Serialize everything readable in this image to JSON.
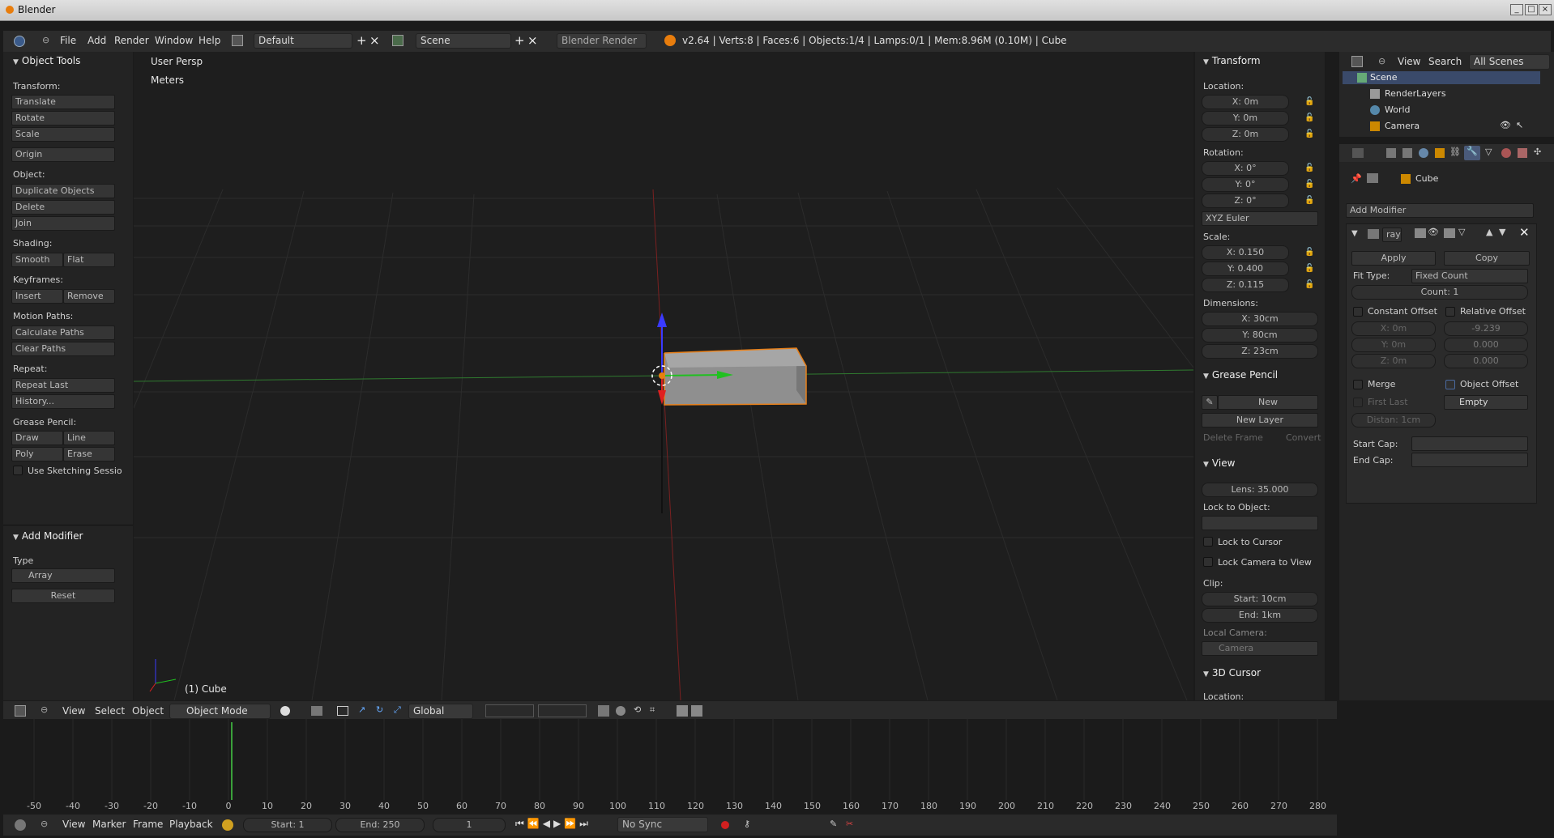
{
  "window": {
    "title": "Blender"
  },
  "header": {
    "menus": [
      "File",
      "Add",
      "Render",
      "Window",
      "Help"
    ],
    "screen_layout": "Default",
    "scene": "Scene",
    "render_engine": "Blender Render",
    "stats": "v2.64 | Verts:8 | Faces:6 | Objects:1/4 | Lamps:0/1 | Mem:8.96M (0.10M) | Cube"
  },
  "tools": {
    "title": "Object Tools",
    "transform_label": "Transform:",
    "translate": "Translate",
    "rotate": "Rotate",
    "scale": "Scale",
    "origin": "Origin",
    "object_label": "Object:",
    "duplicate": "Duplicate Objects",
    "delete": "Delete",
    "join": "Join",
    "shading_label": "Shading:",
    "smooth": "Smooth",
    "flat": "Flat",
    "keyframes_label": "Keyframes:",
    "insert": "Insert",
    "remove": "Remove",
    "motion_label": "Motion Paths:",
    "calc_paths": "Calculate Paths",
    "clear_paths": "Clear Paths",
    "repeat_label": "Repeat:",
    "repeat_last": "Repeat Last",
    "history": "History...",
    "grease_label": "Grease Pencil:",
    "draw": "Draw",
    "line": "Line",
    "poly": "Poly",
    "erase": "Erase",
    "sketching": "Use Sketching Sessio"
  },
  "operator": {
    "title": "Add Modifier",
    "type_label": "Type",
    "type_value": "Array",
    "reset": "Reset"
  },
  "viewport": {
    "persp": "User Persp",
    "units": "Meters",
    "object_label": "(1) Cube"
  },
  "vp_toolbar": {
    "view": "View",
    "select": "Select",
    "object": "Object",
    "mode": "Object Mode",
    "orientation": "Global"
  },
  "properties": {
    "transform_title": "Transform",
    "location_label": "Location:",
    "loc_x": "X: 0m",
    "loc_y": "Y: 0m",
    "loc_z": "Z: 0m",
    "rotation_label": "Rotation:",
    "rot_x": "X: 0°",
    "rot_y": "Y: 0°",
    "rot_z": "Z: 0°",
    "rot_mode": "XYZ Euler",
    "scale_label": "Scale:",
    "scl_x": "X: 0.150",
    "scl_y": "Y: 0.400",
    "scl_z": "Z: 0.115",
    "dim_label": "Dimensions:",
    "dim_x": "X: 30cm",
    "dim_y": "Y: 80cm",
    "dim_z": "Z: 23cm",
    "grease_title": "Grease Pencil",
    "new": "New",
    "new_layer": "New Layer",
    "delete_frame": "Delete Frame",
    "convert": "Convert",
    "view_title": "View",
    "lens": "Lens: 35.000",
    "lock_object": "Lock to Object:",
    "lock_cursor": "Lock to Cursor",
    "lock_camera": "Lock Camera to View",
    "clip_label": "Clip:",
    "clip_start": "Start: 10cm",
    "clip_end": "End: 1km",
    "local_camera": "Local Camera:",
    "camera": "Camera",
    "cursor_title": "3D Cursor",
    "cursor_location": "Location:"
  },
  "outliner": {
    "view": "View",
    "search": "Search",
    "filter": "All Scenes",
    "items": [
      "Scene",
      "RenderLayers",
      "World",
      "Camera"
    ]
  },
  "modifier": {
    "object": "Cube",
    "add_modifier": "Add Modifier",
    "name": "ray",
    "apply": "Apply",
    "copy": "Copy",
    "fit_type_label": "Fit Type:",
    "fit_type": "Fixed Count",
    "count": "Count: 1",
    "constant_offset": "Constant Offset",
    "relative_offset": "Relative Offset",
    "c_x": "X: 0m",
    "c_y": "Y: 0m",
    "c_z": "Z: 0m",
    "r_x": "-9.239",
    "r_y": "0.000",
    "r_z": "0.000",
    "merge": "Merge",
    "object_offset": "Object Offset",
    "first_last": "First Last",
    "empty": "Empty",
    "distance": "Distan: 1cm",
    "start_cap": "Start Cap:",
    "end_cap": "End Cap:"
  },
  "timeline": {
    "ticks": [
      "-50",
      "-40",
      "-30",
      "-20",
      "-10",
      "0",
      "10",
      "20",
      "30",
      "40",
      "50",
      "60",
      "70",
      "80",
      "90",
      "100",
      "110",
      "120",
      "130",
      "140",
      "150",
      "160",
      "170",
      "180",
      "190",
      "200",
      "210",
      "220",
      "230",
      "240",
      "250",
      "260",
      "270",
      "280"
    ],
    "view": "View",
    "marker": "Marker",
    "frame": "Frame",
    "playback": "Playback",
    "start": "Start: 1",
    "end": "End: 250",
    "current": "1",
    "sync": "No Sync"
  }
}
